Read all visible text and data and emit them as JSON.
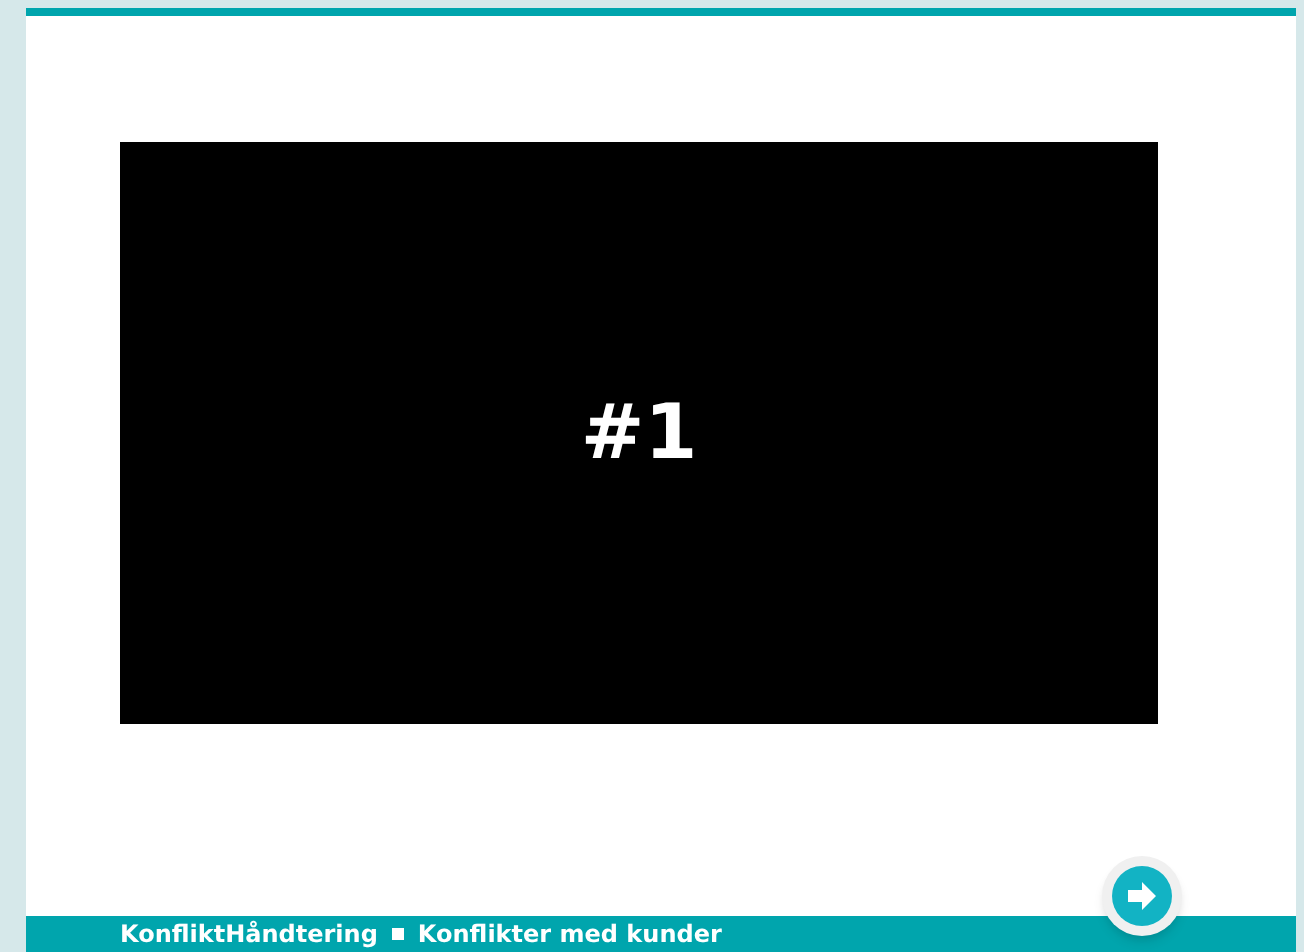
{
  "slide": {
    "panel_text": "#1"
  },
  "footer": {
    "course": "KonfliktHåndtering",
    "lesson": "Konflikter med kunder"
  },
  "next_button": {
    "disabled": false
  }
}
